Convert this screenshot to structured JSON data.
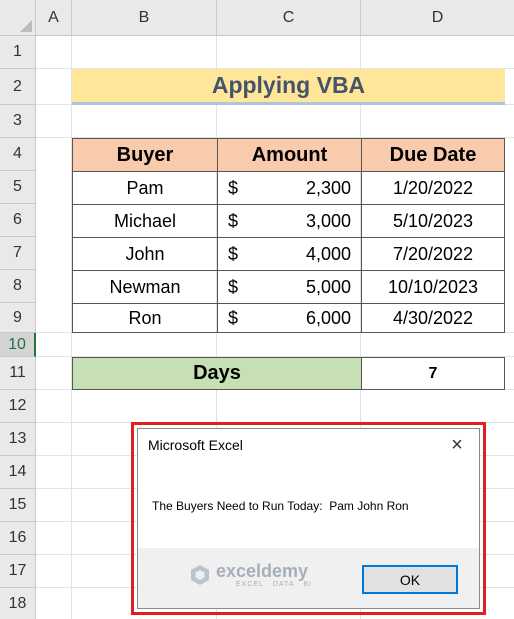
{
  "columns": [
    "A",
    "B",
    "C",
    "D"
  ],
  "rows": [
    "1",
    "2",
    "3",
    "4",
    "5",
    "6",
    "7",
    "8",
    "9",
    "10",
    "11",
    "12",
    "13",
    "14",
    "15",
    "16",
    "17",
    "18"
  ],
  "selected_row": "10",
  "title": "Applying VBA",
  "table": {
    "headers": [
      "Buyer",
      "Amount",
      "Due Date"
    ],
    "rows": [
      {
        "buyer": "Pam",
        "currency": "$",
        "amount": "2,300",
        "due": "1/20/2022"
      },
      {
        "buyer": "Michael",
        "currency": "$",
        "amount": "3,000",
        "due": "5/10/2023"
      },
      {
        "buyer": "John",
        "currency": "$",
        "amount": "4,000",
        "due": "7/20/2022"
      },
      {
        "buyer": "Newman",
        "currency": "$",
        "amount": "5,000",
        "due": "10/10/2023"
      },
      {
        "buyer": "Ron",
        "currency": "$",
        "amount": "6,000",
        "due": "4/30/2022"
      }
    ]
  },
  "days": {
    "label": "Days",
    "value": "7"
  },
  "dialog": {
    "title": "Microsoft Excel",
    "close_icon": "×",
    "message": "The Buyers Need to Run Today:  Pam John Ron",
    "ok_label": "OK"
  },
  "watermark": {
    "name": "exceldemy",
    "tagline": "EXCEL · DATA · BI"
  },
  "colors": {
    "title_bg": "#ffe699",
    "header_bg": "#f8cbad",
    "days_bg": "#c6e0b4",
    "highlight_border": "#e02020"
  }
}
